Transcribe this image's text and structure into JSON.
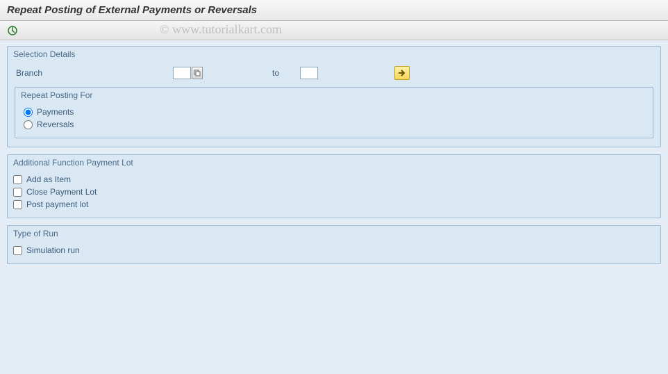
{
  "title": "Repeat Posting of External Payments or Reversals",
  "watermark": "© www.tutorialkart.com",
  "sections": {
    "selection": {
      "title": "Selection Details",
      "branch_label": "Branch",
      "branch_value": "",
      "to_label": "to",
      "to_value": "",
      "repeat": {
        "title": "Repeat Posting For",
        "payments_label": "Payments",
        "reversals_label": "Reversals",
        "selected": "payments"
      }
    },
    "additional": {
      "title": "Additional Function Payment Lot",
      "add_item_label": "Add as Item",
      "close_lot_label": "Close Payment Lot",
      "post_lot_label": "Post payment lot"
    },
    "run_type": {
      "title": "Type of Run",
      "simulation_label": "Simulation run"
    }
  }
}
